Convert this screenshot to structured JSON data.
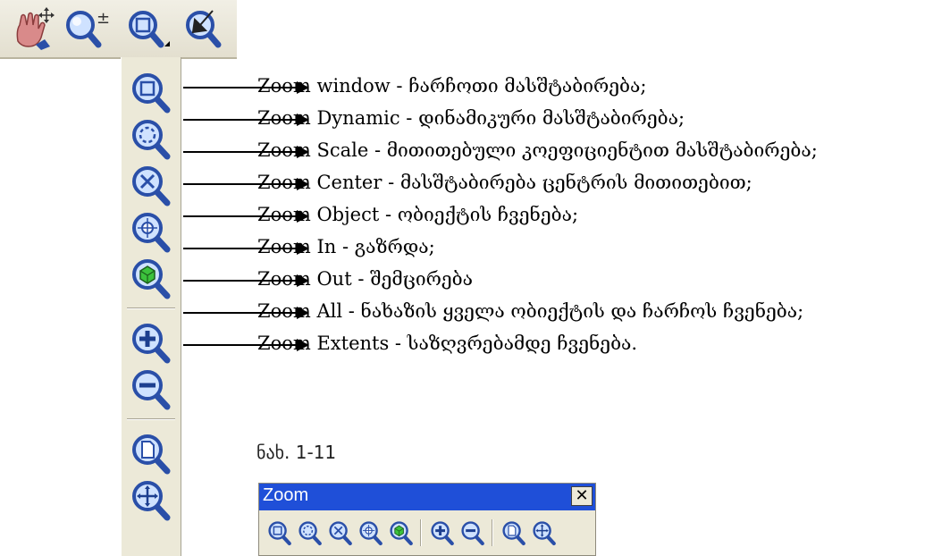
{
  "zoom_items": [
    {
      "name": "Zoom window",
      "desc": "ჩარჩოთი მასშტაბირება;"
    },
    {
      "name": "Zoom Dynamic",
      "desc": "დინამიკური მასშტაბირება;"
    },
    {
      "name": "Zoom Scale",
      "desc": "მითითებული კოეფიციენტით მასშტაბირება;"
    },
    {
      "name": "Zoom Center",
      "desc": "მასშტაბირება ცენტრის მითითებით;"
    },
    {
      "name": "Zoom Object",
      "desc": "ობიექტის ჩვენება;"
    },
    {
      "name": "Zoom In",
      "desc": "გაზრდა;"
    },
    {
      "name": "Zoom Out",
      "desc": "შემცირება"
    },
    {
      "name": "Zoom All",
      "desc": "ნახაზის ყველა ობიექტის და ჩარჩოს ჩვენება;"
    },
    {
      "name": "Zoom Extents",
      "desc": "საზღვრებამდე ჩვენება."
    }
  ],
  "separator": " - ",
  "caption": "ნახ. 1-11",
  "zoom_toolbar": {
    "title": "Zoom",
    "close": "✕"
  },
  "icons": {
    "top_toolbar": [
      "pan-realtime-icon",
      "zoom-realtime-icon",
      "zoom-window-flyout-icon",
      "zoom-previous-icon"
    ],
    "flyout": [
      "zoom-window-icon",
      "zoom-dynamic-icon",
      "zoom-scale-icon",
      "zoom-center-icon",
      "zoom-object-icon",
      "zoom-in-icon",
      "zoom-out-icon",
      "zoom-all-icon",
      "zoom-extents-icon"
    ]
  },
  "colors": {
    "titlebar": "#1f4fd8",
    "toolbar_bg": "#ece9d8",
    "lens": "#2a4fa8"
  }
}
